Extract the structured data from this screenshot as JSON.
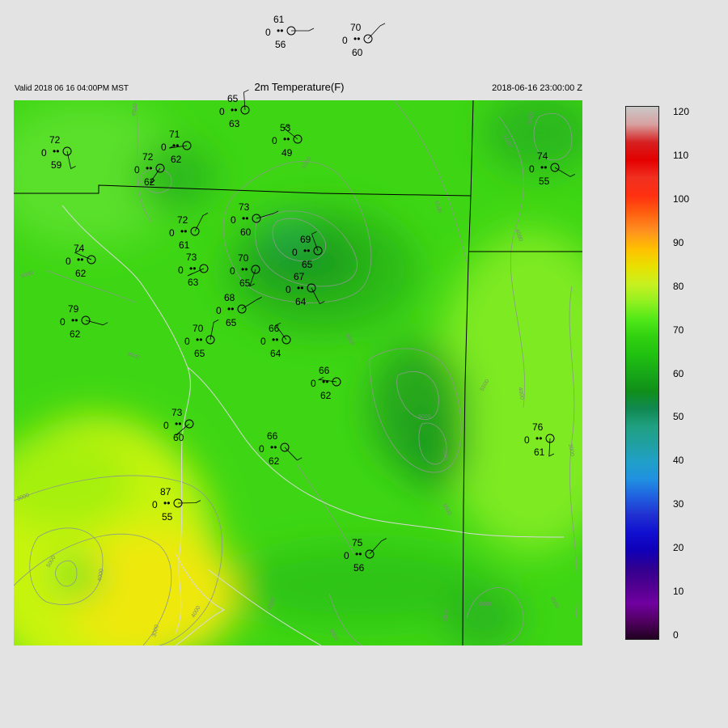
{
  "header": {
    "valid_time": "Valid 2018 06 16 04:00PM MST",
    "title": "2m Temperature(F)",
    "utc_time": "2018-06-16  23:00:00 Z"
  },
  "legend": {
    "ticks": [
      "120",
      "110",
      "100",
      "90",
      "80",
      "70",
      "60",
      "50",
      "40",
      "30",
      "20",
      "10",
      "0"
    ]
  },
  "contour_labels": [
    "3000",
    "4000",
    "5000",
    "6000",
    "4500",
    "5500",
    "7000"
  ],
  "stations": [
    {
      "temp": "61",
      "dew": "56",
      "vis": "0"
    },
    {
      "temp": "70",
      "dew": "60",
      "vis": "0"
    },
    {
      "temp": "65",
      "dew": "63",
      "vis": "0"
    },
    {
      "temp": "53",
      "dew": "49",
      "vis": "0"
    },
    {
      "temp": "71",
      "dew": "62",
      "vis": "0"
    },
    {
      "temp": "72",
      "dew": "62",
      "vis": "0"
    },
    {
      "temp": "72",
      "dew": "59",
      "vis": "0"
    },
    {
      "temp": "74",
      "dew": "55",
      "vis": "0"
    },
    {
      "temp": "73",
      "dew": "60",
      "vis": "0"
    },
    {
      "temp": "72",
      "dew": "61",
      "vis": "0"
    },
    {
      "temp": "69",
      "dew": "65",
      "vis": "0"
    },
    {
      "temp": "74",
      "dew": "62",
      "vis": "0"
    },
    {
      "temp": "73",
      "dew": "63",
      "vis": "0"
    },
    {
      "temp": "70",
      "dew": "65",
      "vis": "0"
    },
    {
      "temp": "67",
      "dew": "64",
      "vis": "0"
    },
    {
      "temp": "79",
      "dew": "62",
      "vis": "0"
    },
    {
      "temp": "68",
      "dew": "65",
      "vis": "0"
    },
    {
      "temp": "70",
      "dew": "65",
      "vis": "0"
    },
    {
      "temp": "66",
      "dew": "64",
      "vis": "0"
    },
    {
      "temp": "66",
      "dew": "62",
      "vis": "0"
    },
    {
      "temp": "73",
      "dew": "60",
      "vis": "0"
    },
    {
      "temp": "76",
      "dew": "61",
      "vis": "0"
    },
    {
      "temp": "66",
      "dew": "62",
      "vis": "0"
    },
    {
      "temp": "87",
      "dew": "55",
      "vis": "0"
    },
    {
      "temp": "75",
      "dew": "56",
      "vis": "0"
    }
  ]
}
